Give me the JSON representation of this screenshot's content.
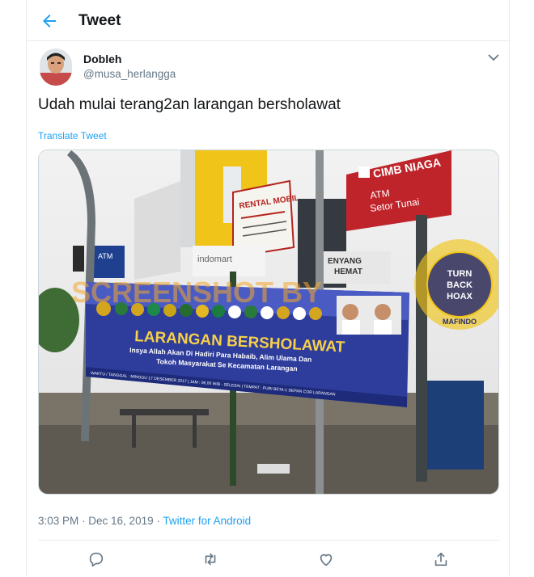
{
  "header": {
    "title": "Tweet"
  },
  "tweet": {
    "author_name": "Dobleh",
    "author_handle": "@musa_herlangga",
    "text": "Udah mulai terang2an larangan bersholawat",
    "translate_label": "Translate Tweet",
    "time": "3:03 PM",
    "date": "Dec 16, 2019",
    "separator": " · ",
    "source": "Twitter for Android"
  },
  "photo": {
    "watermark": "SCREENSHOT BY",
    "cimb_sign": "CIMB NIAGA",
    "atm_line1": "ATM",
    "atm_line2": "Setor Tunai",
    "atm_small": "ATM",
    "rental_line1": "RENTAL MOBIL",
    "indomaret": "indomart",
    "store_line1": "ENYANG",
    "store_line2": "HEMAT",
    "banner_title": "LARANGAN BERSHOLAWAT",
    "banner_line1": "Insya Allah Akan Di Hadiri Para Habaib, Alim Ulama Dan",
    "banner_line2": "Tokoh Masyarakat Se Kecamatan Larangan",
    "banner_footer": "WAKTU / TANGGAL : MINGGU 17 DESEMBER 2017 | JAM : 06.00 WIB - SELESAI | TEMPAT : PURI BETA-1 DEPAN COR LARANGAN",
    "stamp_line1": "TURN",
    "stamp_line2": "BACK",
    "stamp_line3": "HOAX",
    "stamp_ring": "MASYARAKAT ANTI FITNAH INDONESIA",
    "stamp_bottom": "MAFINDO"
  },
  "icons": {
    "back": "arrow-left-icon",
    "caret": "chevron-down-icon",
    "reply": "reply-icon",
    "retweet": "retweet-icon",
    "like": "heart-icon",
    "share": "share-icon"
  },
  "colors": {
    "accent": "#1da1f2",
    "text": "#14171a",
    "secondary": "#657786",
    "border": "#e6ecf0"
  }
}
